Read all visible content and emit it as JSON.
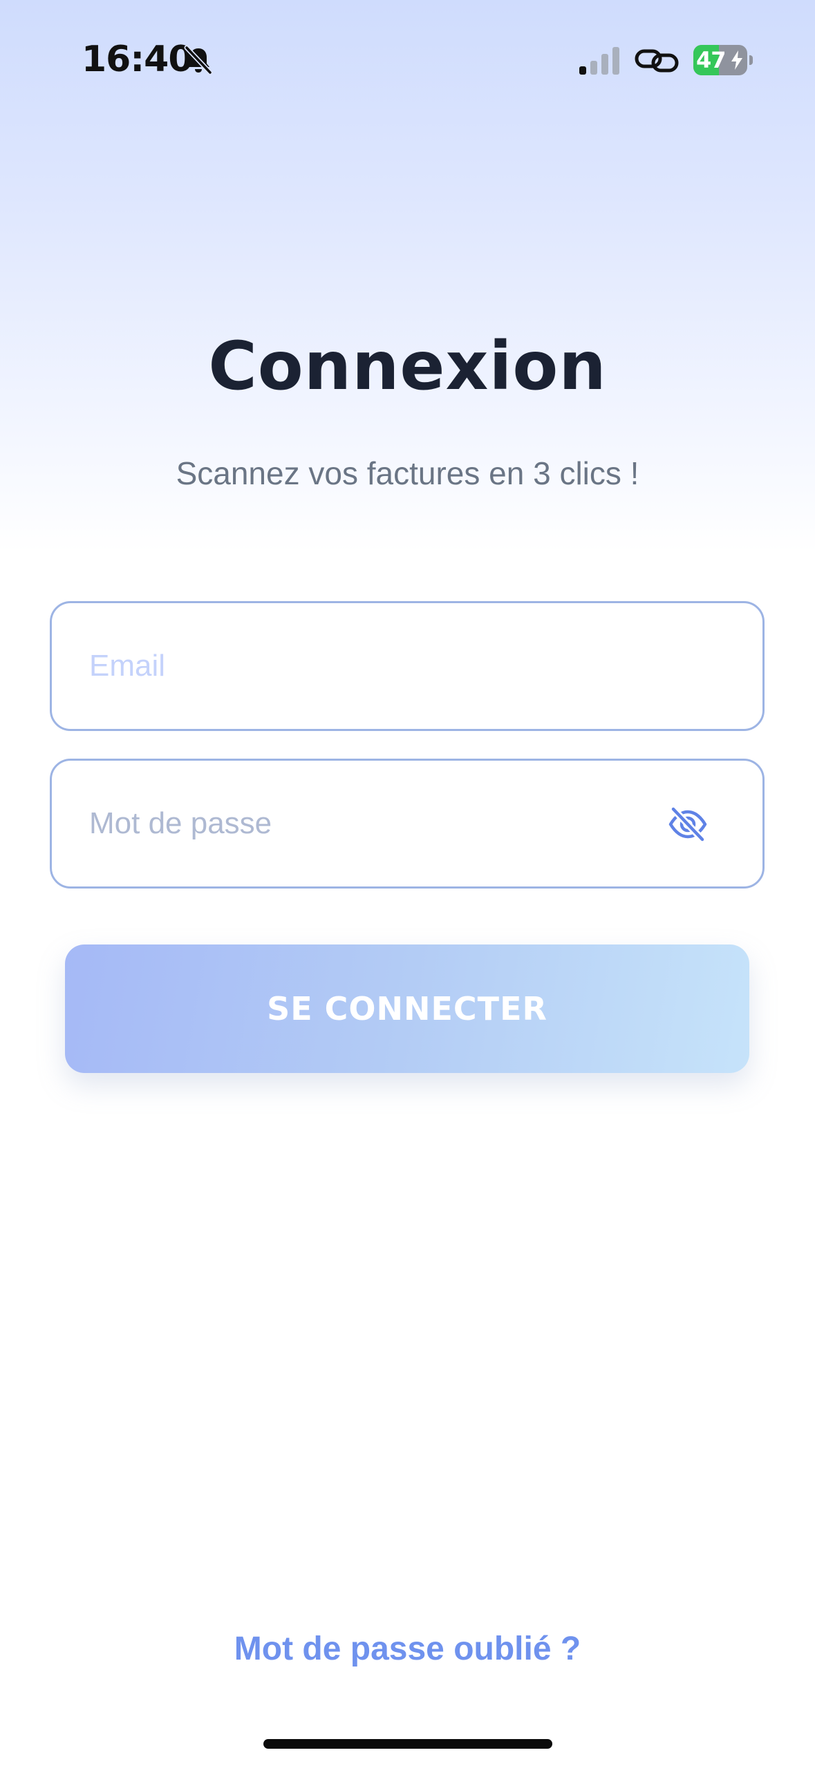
{
  "status_bar": {
    "time": "16:40",
    "battery_percent": "47",
    "battery_level": 0.47,
    "charging": true,
    "icons": [
      "bell-slash-icon",
      "signal-icon",
      "link-icon",
      "battery-icon"
    ]
  },
  "login": {
    "title": "Connexion",
    "subtitle": "Scannez vos factures en 3 clics !",
    "email_placeholder": "Email",
    "email_value": "",
    "password_placeholder": "Mot de passe",
    "password_value": "",
    "password_toggle_icon": "eye-off-icon",
    "submit_label": "SE CONNECTER",
    "forgot_password_label": "Mot de passe oublié ?"
  },
  "colors": {
    "title": "#1b2233",
    "subtitle": "#6a7585",
    "field_border": "#9db4e4",
    "button_start": "#a5b9f6",
    "button_end": "#c6e3fa",
    "link": "#6f92ee",
    "battery_green": "#35c759"
  }
}
